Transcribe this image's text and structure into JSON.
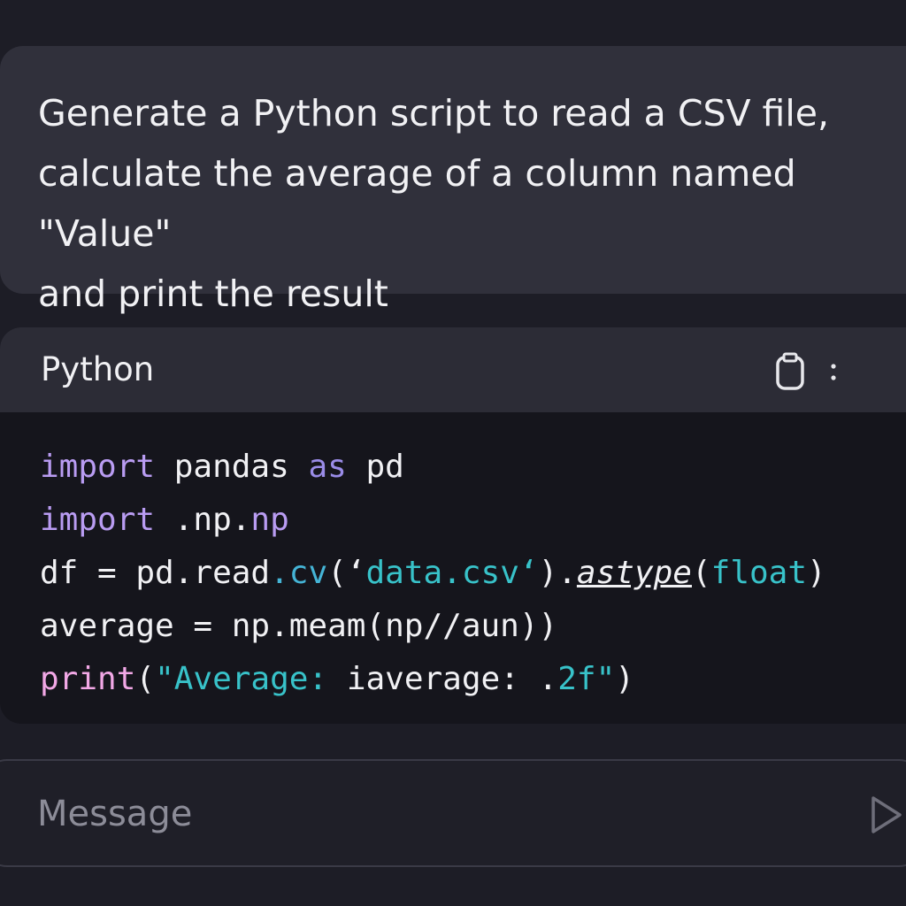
{
  "conversation": {
    "user_message": "Generate a Python script to read a CSV file,\ncalculate the average of a column named \"Value\"\nand print the result"
  },
  "code_block": {
    "language": "Python",
    "lines": [
      [
        {
          "text": "import",
          "kind": "kw"
        },
        {
          "text": " pandas ",
          "kind": "plain"
        },
        {
          "text": "as",
          "kind": "kw2"
        },
        {
          "text": " pd",
          "kind": "plain"
        }
      ],
      [
        {
          "text": "import",
          "kind": "kw"
        },
        {
          "text": " .np.",
          "kind": "plain"
        },
        {
          "text": "np",
          "kind": "kw"
        }
      ],
      [
        {
          "text": "df = pd.read",
          "kind": "plain"
        },
        {
          "text": ".cv",
          "kind": "fn"
        },
        {
          "text": "(‘",
          "kind": "plain"
        },
        {
          "text": "data.csv‘",
          "kind": "str"
        },
        {
          "text": ").",
          "kind": "plain"
        },
        {
          "text": "astype",
          "kind": "it"
        },
        {
          "text": "(",
          "kind": "plain"
        },
        {
          "text": "float",
          "kind": "str"
        },
        {
          "text": ")",
          "kind": "plain"
        }
      ],
      [
        {
          "text": "average = np.meam(np//aun))",
          "kind": "plain"
        }
      ],
      [
        {
          "text": "print",
          "kind": "pr"
        },
        {
          "text": "(",
          "kind": "plain"
        },
        {
          "text": "\"Average: ",
          "kind": "str"
        },
        {
          "text": "iaverage: .",
          "kind": "plain"
        },
        {
          "text": "2f\"",
          "kind": "str"
        },
        {
          "text": ")",
          "kind": "plain"
        }
      ]
    ],
    "icons": {
      "copy": "clipboard-icon",
      "more": "more-vertical-icon"
    },
    "colors": {
      "keyword": "#b99cf2",
      "function": "#45b4d6",
      "string": "#38c2c9",
      "print": "#f2a8e6"
    }
  },
  "composer": {
    "placeholder": "Message",
    "send_icon": "send-icon"
  }
}
